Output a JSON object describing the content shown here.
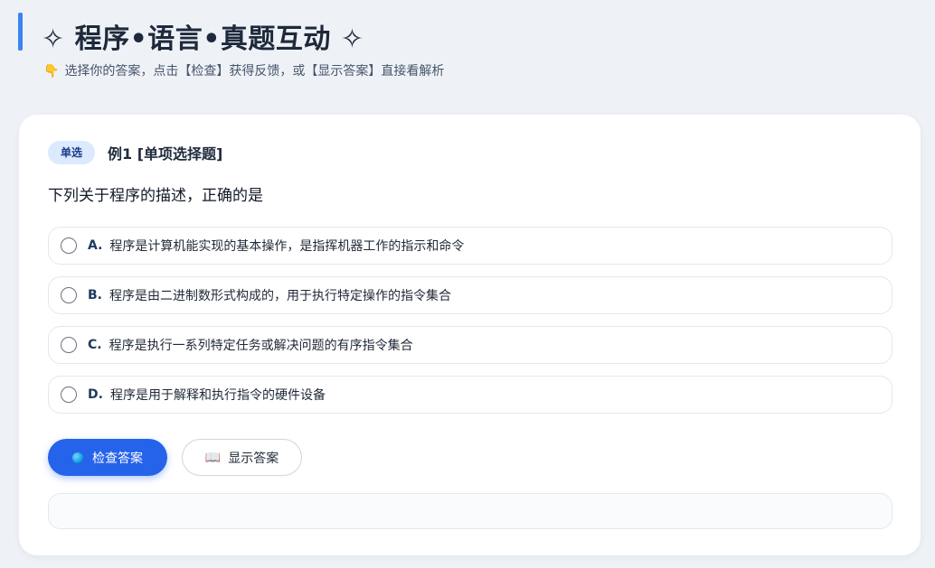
{
  "header": {
    "title": "✧ 程序•语言•真题互动 ✧",
    "hint_icon": "👇",
    "hint": "选择你的答案，点击【检查】获得反馈，或【显示答案】直接看解析"
  },
  "question": {
    "tag": "单选",
    "title": "例1 [单项选择题]",
    "stem": "下列关于程序的描述，正确的是",
    "options": [
      {
        "letter": "A.",
        "text": "程序是计算机能实现的基本操作，是指挥机器工作的指示和命令"
      },
      {
        "letter": "B.",
        "text": "程序是由二进制数形式构成的，用于执行特定操作的指令集合"
      },
      {
        "letter": "C.",
        "text": "程序是执行一系列特定任务或解决问题的有序指令集合"
      },
      {
        "letter": "D.",
        "text": "程序是用于解释和执行指令的硬件设备"
      }
    ]
  },
  "actions": {
    "check_label": "检查答案",
    "show_label": "显示答案",
    "check_icon": "globe-icon",
    "show_icon": "book-icon",
    "book_glyph": "📖"
  },
  "colors": {
    "accent": "#3b82f6",
    "primary_button": "#2563eb",
    "tag_bg": "#dbeafe",
    "page_bg": "#eef2f7"
  }
}
